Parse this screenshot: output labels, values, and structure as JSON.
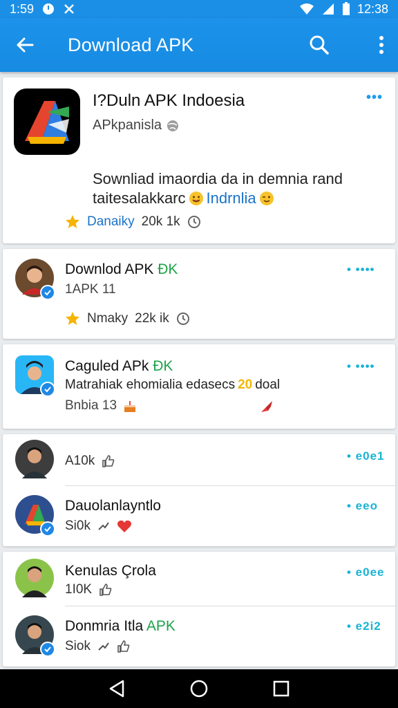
{
  "status_bar": {
    "time_left": "1:59",
    "time_right": "12:38"
  },
  "app_bar": {
    "title": "Download APK"
  },
  "featured": {
    "title": "I?Duln APK Indoesia",
    "subtitle": "APkpanisla",
    "desc_line1": "Sownliad imaordia da in demnia rand",
    "desc_line2_a": "taitesalakkarc",
    "desc_line2_b": "Indrnlia",
    "rating_label": "Danaiky",
    "stat": "20k 1k"
  },
  "items": [
    {
      "name_a": "Downlod APK",
      "name_b": "ÐK",
      "sub": "1APK   11",
      "meta_label": "Nmaky",
      "meta_stat": "22k ik"
    },
    {
      "name_a": "Caguled APk",
      "name_b": "ÐK",
      "desc_a": "Matrahiak ehomialia edasecs",
      "desc_b": "20",
      "desc_c": "doal",
      "sub": "Bnbia 13"
    },
    {
      "stat": "A10k"
    },
    {
      "name": "Dauolanlayntlo",
      "stat": "Si0k"
    },
    {
      "name": "Kenulas Çrola",
      "stat": "1I0K"
    },
    {
      "name_a": "Donmria Itla",
      "name_b": "APK",
      "stat": "Siok"
    }
  ],
  "dots": [
    "•••",
    "• ••••",
    "• ••••",
    "• e0e1",
    "• eeo",
    "• e0ee",
    "• e2i2"
  ],
  "colors": {
    "primary": "#1b8fe6",
    "verified": "#1e88e5",
    "green": "#1fa24a",
    "dots": "#18b3d4"
  }
}
